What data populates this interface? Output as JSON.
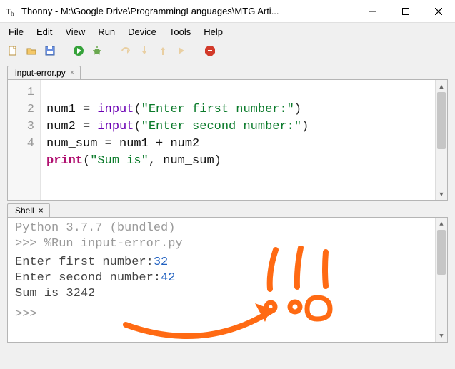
{
  "window": {
    "title": "Thonny  -  M:\\Google Drive\\ProgrammingLanguages\\MTG Arti..."
  },
  "menu": {
    "file": "File",
    "edit": "Edit",
    "view": "View",
    "run": "Run",
    "device": "Device",
    "tools": "Tools",
    "help": "Help"
  },
  "editor": {
    "tab_label": "input-error.py",
    "line_numbers": [
      "1",
      "2",
      "3",
      "4"
    ],
    "code": {
      "l1": {
        "lhs": "num1",
        "eq": " = ",
        "fn": "input",
        "lp": "(",
        "str": "\"Enter first number:\"",
        "rp": ")"
      },
      "l2": {
        "lhs": "num2",
        "eq": " = ",
        "fn": "input",
        "lp": "(",
        "str": "\"Enter second number:\"",
        "rp": ")"
      },
      "l3": {
        "lhs": "num_sum",
        "eq": " = ",
        "rhs": "num1 + num2"
      },
      "l4": {
        "fn": "print",
        "lp": "(",
        "str": "\"Sum is\"",
        "comma": ", ",
        "arg": "num_sum",
        "rp": ")"
      }
    }
  },
  "shell": {
    "tab_label": "Shell",
    "banner": "Python 3.7.7 (bundled)",
    "run_line": ">>> %Run input-error.py",
    "io": {
      "p1_prompt": " Enter first number:",
      "p1_val": "32",
      "p2_prompt": " Enter second number:",
      "p2_val": "42",
      "out": " Sum is 3242"
    },
    "prompt": ">>> "
  }
}
